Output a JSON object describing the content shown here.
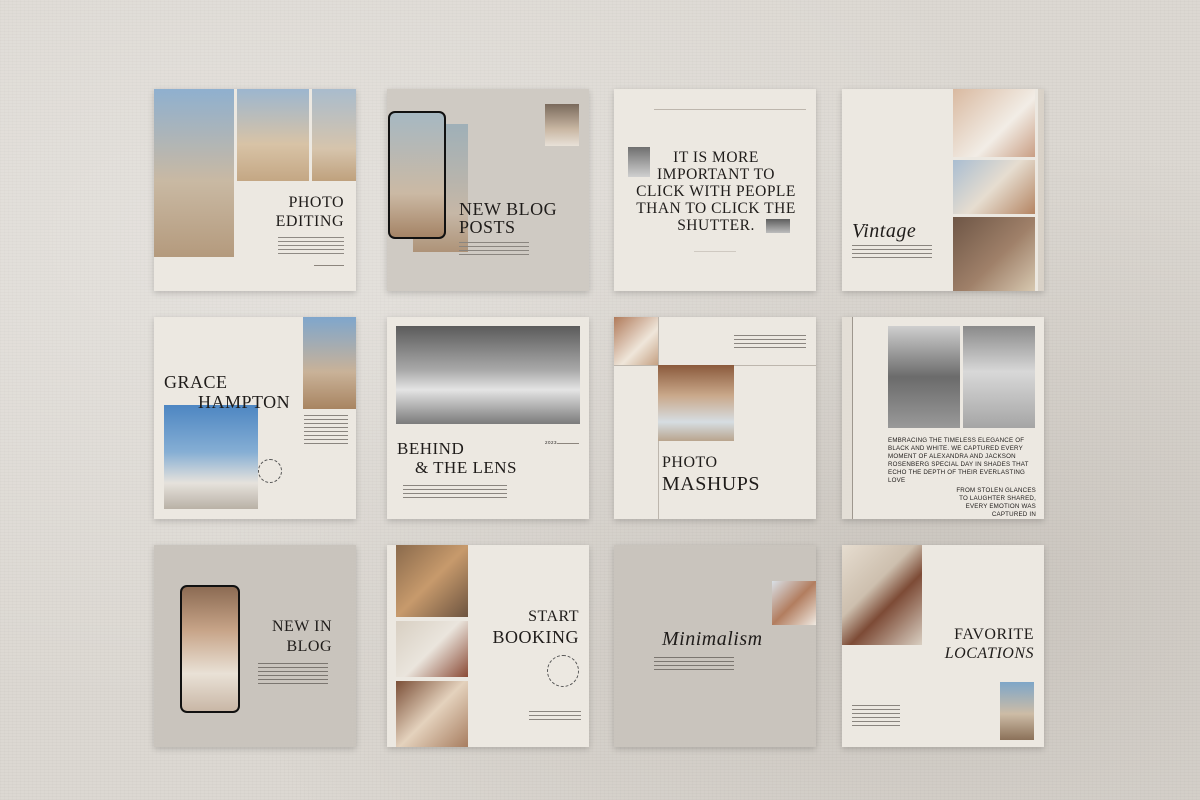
{
  "cards": {
    "photo_editing": {
      "line1": "PHOTO",
      "line2": "EDITING"
    },
    "new_blog_posts": {
      "line1": "NEW BLOG",
      "line2": "POSTS"
    },
    "quote": {
      "text": "IT IS MORE IMPORTANT TO CLICK WITH PEOPLE THAN TO CLICK THE SHUTTER."
    },
    "vintage": {
      "title": "Vintage"
    },
    "grace_hampton": {
      "line1": "GRACE",
      "line2": "HAMPTON"
    },
    "behind_the_lens": {
      "line1": "BEHIND",
      "line2": "& THE LENS",
      "year": "2023"
    },
    "photo_mashups": {
      "line1": "PHOTO",
      "line2": "MASHUPS"
    },
    "black_white": {
      "para1": "EMBRACING THE TIMELESS ELEGANCE OF BLACK AND WHITE. WE CAPTURED EVERY MOMENT OF ALEXANDRA AND JACKSON ROSENBERG SPECIAL DAY IN SHADES THAT ECHO THE DEPTH OF THEIR EVERLASTING LOVE",
      "para2": "FROM STOLEN GLANCES TO LAUGHTER SHARED, EVERY EMOTION WAS CAPTURED IN MONOCHROME"
    },
    "new_in_blog": {
      "line1": "NEW IN",
      "line2": "BLOG"
    },
    "start_booking": {
      "line1": "START",
      "line2": "BOOKING"
    },
    "minimalism": {
      "title": "Minimalism"
    },
    "favorite_locations": {
      "line1": "FAVORITE",
      "line2": "LOCATIONS"
    }
  },
  "colors": {
    "card": "#ece8e1",
    "card_gray": "#c9c4bd",
    "ink": "#1f1c1a",
    "background": "#dcd8d2"
  }
}
